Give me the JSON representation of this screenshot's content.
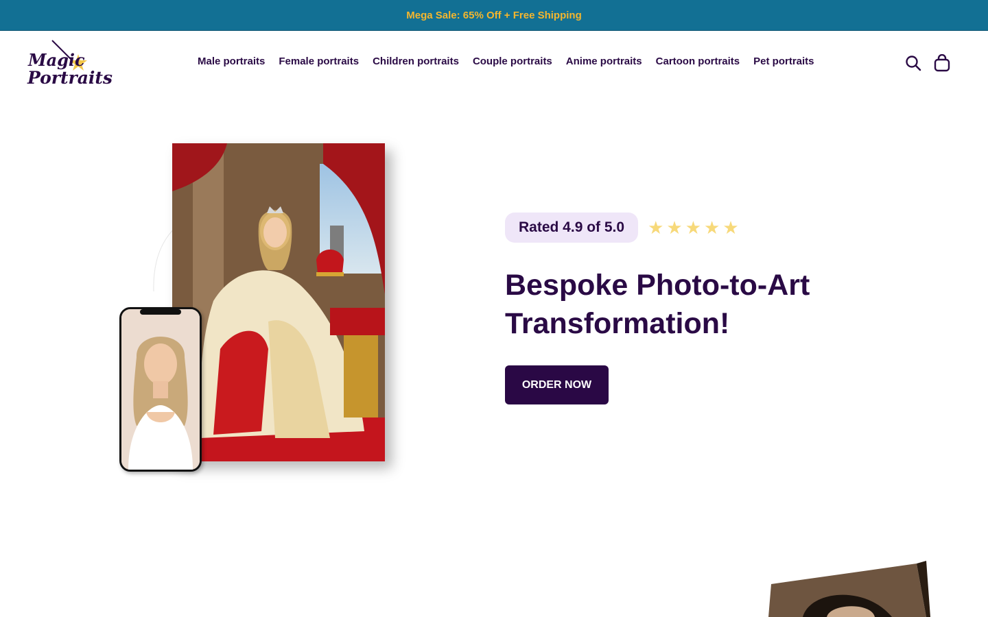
{
  "announcement": {
    "text": "Mega Sale: 65% Off + Free Shipping"
  },
  "logo": {
    "line1": "Magic",
    "line2": "Portraits"
  },
  "nav": {
    "items": [
      {
        "label": "Male portraits"
      },
      {
        "label": "Female portraits"
      },
      {
        "label": "Children portraits"
      },
      {
        "label": "Couple portraits"
      },
      {
        "label": "Anime portraits"
      },
      {
        "label": "Cartoon portraits"
      },
      {
        "label": "Pet portraits"
      }
    ]
  },
  "header_icons": {
    "search": "search-icon",
    "cart": "shopping-bag-icon"
  },
  "hero": {
    "rating_text": "Rated 4.9 of 5.0",
    "stars": 5,
    "headline": "Bespoke Photo-to-Art Transformation!",
    "cta_label": "ORDER NOW"
  },
  "colors": {
    "announcement_bg": "#127094",
    "announcement_text": "#f4b62e",
    "brand_dark": "#2a0845",
    "rating_pill_bg": "#efe6f8",
    "star": "#f7d97a"
  }
}
